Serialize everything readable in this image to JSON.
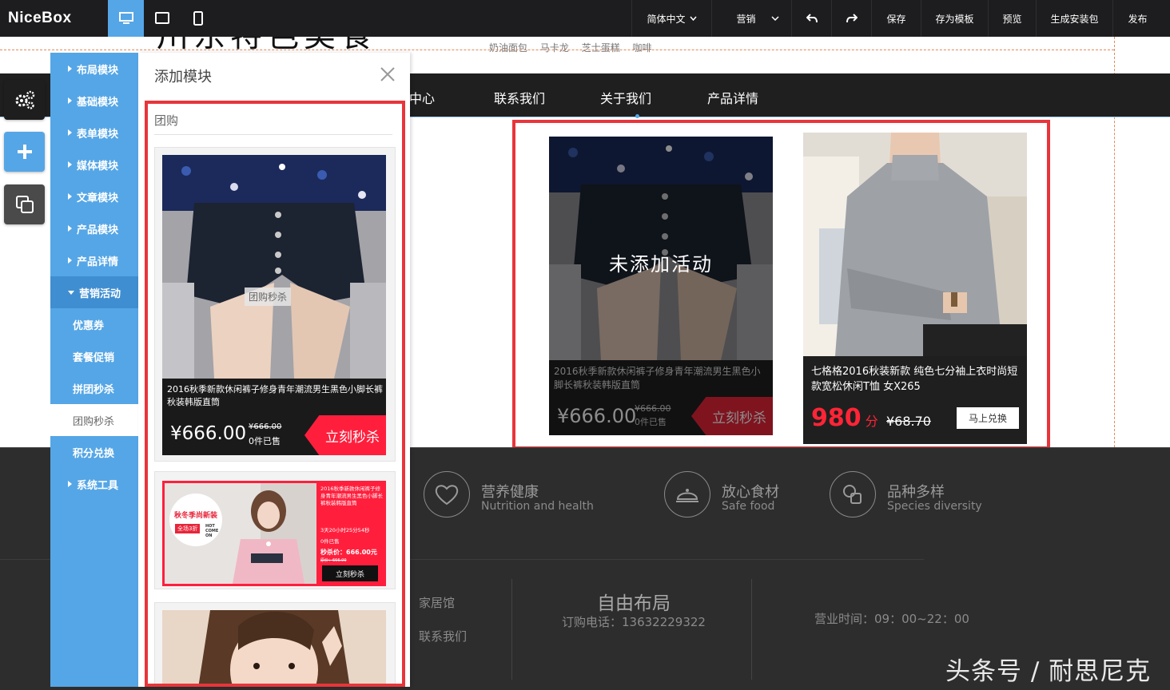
{
  "toolbar": {
    "logo": "NiceBox",
    "language": "简体中文",
    "marketing": "营销",
    "save": "保存",
    "save_template": "存为模板",
    "preview": "预览",
    "build_package": "生成安装包",
    "publish": "发布"
  },
  "page": {
    "hero_title": "川东特色美食",
    "hero_links": [
      "奶油面包",
      "马卡龙",
      "芝士蛋糕",
      "咖啡"
    ],
    "nav": [
      "产品中心",
      "联系我们",
      "关于我们",
      "产品详情"
    ]
  },
  "showcase": {
    "left": {
      "overlay": "未添加活动",
      "title": "2016秋季新款休闲裤子修身青年潮流男生黑色小脚长裤秋装韩版直筒",
      "price": "¥666.00",
      "old_price": "¥666.00",
      "sold": "0件已售",
      "cta": "立刻秒杀"
    },
    "right": {
      "title": "七格格2016秋装新款 纯色七分袖上衣时尚短款宽松休闲T恤 女X265",
      "points": "980",
      "points_unit": "分",
      "old_price": "¥68.70",
      "cta": "马上兑换"
    }
  },
  "features": [
    {
      "title": "营养健康",
      "sub": "Nutrition and health"
    },
    {
      "title": "放心食材",
      "sub": "Safe food"
    },
    {
      "title": "品种多样",
      "sub": "Species diversity"
    }
  ],
  "footer": {
    "links": [
      "家居馆",
      "联系我们"
    ],
    "free_layout": "自由布局",
    "phone": "订购电话：13632229322",
    "hours": "营业时间：09：00~22：00"
  },
  "watermark": "头条号 / 耐思尼克",
  "categories": [
    {
      "label": "布局模块"
    },
    {
      "label": "基础模块"
    },
    {
      "label": "表单模块"
    },
    {
      "label": "媒体模块"
    },
    {
      "label": "文章模块"
    },
    {
      "label": "产品模块"
    },
    {
      "label": "产品详情"
    },
    {
      "label": "营销活动"
    }
  ],
  "subcategories": [
    {
      "label": "优惠券"
    },
    {
      "label": "套餐促销"
    },
    {
      "label": "拼团秒杀"
    },
    {
      "label": "团购秒杀"
    },
    {
      "label": "积分兑换"
    }
  ],
  "system_tools": "系统工具",
  "panel": {
    "title": "添加模块",
    "group": "团购",
    "card1": {
      "tag": "团购秒杀",
      "title": "2016秋季新款休闲裤子修身青年潮流男生黑色小脚长裤秋装韩版直筒",
      "price": "¥666.00",
      "old_price": "¥666.00",
      "sold": "0件已售",
      "cta": "立刻秒杀"
    },
    "card2": {
      "badge_line1": "秋冬季尚新装",
      "badge_discount": "全场3折",
      "badge_hot": "HOT COME ON",
      "title": "2016秋季新款休闲裤子修身青年潮流男生黑色小脚长裤秋装韩版直筒",
      "countdown": "3天20小时25分54秒",
      "sold": "0件已售",
      "price_label": "秒杀价：666.00元",
      "old_price": "原价：666.00",
      "cta": "立刻秒杀"
    }
  }
}
